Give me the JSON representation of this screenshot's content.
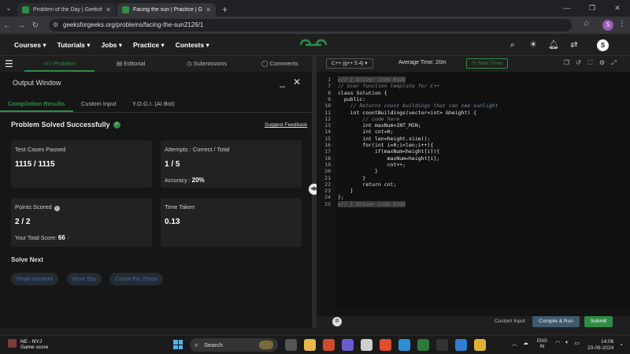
{
  "browser": {
    "tabs": [
      {
        "title": "Problem of the Day | GeeksforG..."
      },
      {
        "title": "Facing the sun | Practice | Geek..."
      }
    ],
    "url": "geeksforgeeks.org/problems/facing-the-sun2126/1",
    "profile_initial": "S"
  },
  "gfg_header": {
    "menu": [
      "Courses ▾",
      "Tutorials ▾",
      "Jobs ▾",
      "Practice ▾",
      "Contests ▾"
    ],
    "logo_text": "GfG",
    "avatar_initial": "S"
  },
  "left_tabs": {
    "problem": "</> Problem",
    "editorial": "Editorial",
    "submissions": "Submissions",
    "comments": "Comments"
  },
  "output": {
    "title": "Output Window",
    "tabs": [
      "Compilation Results",
      "Custom Input",
      "Y.O.G.I. (AI Bot)"
    ],
    "status": "Problem Solved Successfully",
    "feedback": "Suggest Feedback",
    "test_cases_label": "Test Cases Passed",
    "test_cases_value": "1115 / 1115",
    "attempts_label": "Attempts : Correct / Total",
    "attempts_value": "1 / 5",
    "accuracy_label": "Accuracy :",
    "accuracy_value": "20%",
    "points_label": "Points Scored",
    "points_value": "2 / 2",
    "total_score_label": "Your Total Score:",
    "total_score_value": "66",
    "time_label": "Time Taken",
    "time_value": "0.13",
    "solve_next": "Solve Next",
    "next_tags": [
      "Peak element",
      "Root Top",
      "Count the Zeros"
    ]
  },
  "editor": {
    "language": "C++ (g++ 5.4) ▾",
    "average_time": "Average Time: 20m",
    "timer": "◷ Start Timer",
    "line_numbers": [
      "1",
      "7",
      "8",
      "9",
      "10",
      "11",
      "12",
      "13",
      "14",
      "15",
      "16",
      "17",
      "18",
      "19",
      "20",
      "21",
      "22",
      "23",
      "24",
      "25"
    ],
    "lines": [
      {
        "text": "▸// } Driver Code Ends",
        "cls": "cm"
      },
      {
        "text": "// User function template for C++",
        "cls": "cm"
      },
      {
        "text": "class Solution {",
        "cls": ""
      },
      {
        "text": "  public:",
        "cls": ""
      },
      {
        "text": "    // Returns count buildings that can see sunlight",
        "cls": "cm"
      },
      {
        "text": "    int countBuildings(vector<int> &height) {",
        "cls": ""
      },
      {
        "text": "        // code here",
        "cls": "cm"
      },
      {
        "text": "        int maxNum=INT_MIN;",
        "cls": ""
      },
      {
        "text": "        int cnt=0;",
        "cls": ""
      },
      {
        "text": "        int len=height.size();",
        "cls": ""
      },
      {
        "text": "        for(int i=0;i<len;i++){",
        "cls": ""
      },
      {
        "text": "            if(maxNum<height[i]){",
        "cls": ""
      },
      {
        "text": "                maxNum=height[i];",
        "cls": ""
      },
      {
        "text": "                cnt++;",
        "cls": ""
      },
      {
        "text": "            }",
        "cls": ""
      },
      {
        "text": "        }",
        "cls": ""
      },
      {
        "text": "        return cnt;",
        "cls": ""
      },
      {
        "text": "    }",
        "cls": ""
      },
      {
        "text": "};",
        "cls": ""
      },
      {
        "text": "▸// } Driver Code Ends",
        "cls": "cm"
      }
    ],
    "custom_input": "Custom Input",
    "compile": "Compile & Run",
    "submit": "Submit"
  },
  "taskbar": {
    "weather_title": "NE - NYJ",
    "weather_sub": "Game score",
    "search": "Search",
    "lang_top": "ENG",
    "lang_bottom": "IN",
    "time": "14:06",
    "date": "20-09-2024"
  }
}
